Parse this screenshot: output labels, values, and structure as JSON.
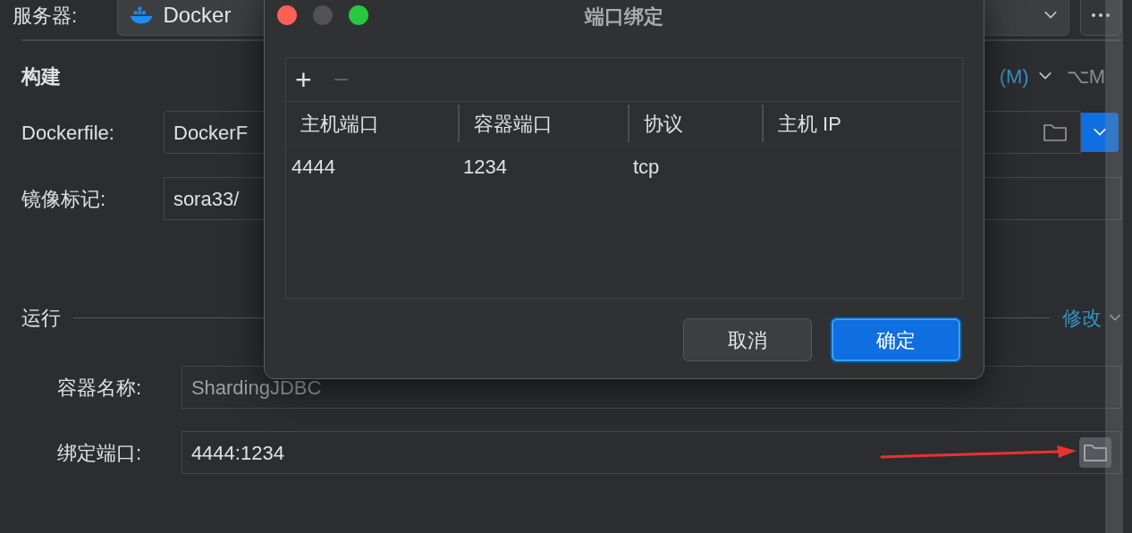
{
  "server": {
    "label": "服务器:",
    "value": "Docker"
  },
  "build": {
    "title": "构建",
    "modify_link": "(M)",
    "shortcut": "⌥M",
    "dockerfile": {
      "label": "Dockerfile:",
      "value": "DockerF"
    },
    "image_tag": {
      "label": "镜像标记:",
      "value": "sora33/"
    }
  },
  "run": {
    "title": "运行",
    "modify_link": "修改",
    "container_name": {
      "label": "容器名称:",
      "value": "ShardingJDBC"
    },
    "port_bindings": {
      "label": "绑定端口:",
      "value": "4444:1234"
    }
  },
  "dialog": {
    "title": "端口绑定",
    "add": "+",
    "remove": "−",
    "columns": [
      "主机端口",
      "容器端口",
      "协议",
      "主机 IP"
    ],
    "rows": [
      {
        "cells": [
          "4444",
          "1234",
          "tcp",
          ""
        ]
      }
    ],
    "buttons": [
      {
        "label": "取消",
        "kind": "secondary"
      },
      {
        "label": "确定",
        "kind": "primary"
      }
    ]
  }
}
